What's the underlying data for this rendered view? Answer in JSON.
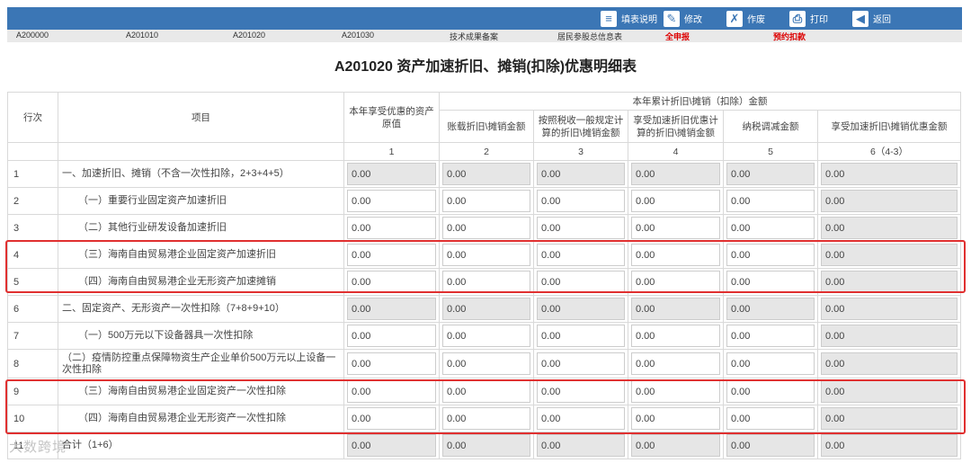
{
  "toolbar": {
    "buttons": [
      {
        "label": "填表说明",
        "icon": "document-icon"
      },
      {
        "label": "修改",
        "icon": "pencil-icon"
      },
      {
        "label": "作废",
        "icon": "void-document-icon"
      },
      {
        "label": "打印",
        "icon": "printer-icon"
      },
      {
        "label": "返回",
        "icon": "back-arrow-icon"
      }
    ]
  },
  "tabs": [
    "A200000",
    "A201010",
    "A201020",
    "A201030",
    "技术成果备案",
    "居民参股总信息表",
    "全申报",
    "预约扣款"
  ],
  "title": "A201020 资产加速折旧、摊销(扣除)优惠明细表",
  "header": {
    "row_no": "行次",
    "item": "项目",
    "col1": "本年享受优惠的资产原值",
    "group": "本年累计折旧\\摊销（扣除）金额",
    "col2": "账载折旧\\摊销金额",
    "col3": "按照税收一般规定计算的折旧\\摊销金额",
    "col4": "享受加速折旧优惠计算的折旧\\摊销金额",
    "col5": "纳税调减金额",
    "col6": "享受加速折旧\\摊销优惠金额",
    "nums": [
      "1",
      "2",
      "3",
      "4",
      "5",
      "6（4-3）"
    ]
  },
  "rows": [
    {
      "no": "1",
      "item": "一、加速折旧、摊销（不含一次性扣除，2+3+4+5）",
      "values": [
        "0.00",
        "0.00",
        "0.00",
        "0.00",
        "0.00",
        "0.00"
      ]
    },
    {
      "no": "2",
      "item": "（一）重要行业固定资产加速折旧",
      "values": [
        "0.00",
        "0.00",
        "0.00",
        "0.00",
        "0.00",
        "0.00"
      ]
    },
    {
      "no": "3",
      "item": "（二）其他行业研发设备加速折旧",
      "values": [
        "0.00",
        "0.00",
        "0.00",
        "0.00",
        "0.00",
        "0.00"
      ]
    },
    {
      "no": "4",
      "item": "（三）海南自由贸易港企业固定资产加速折旧",
      "values": [
        "0.00",
        "0.00",
        "0.00",
        "0.00",
        "0.00",
        "0.00"
      ]
    },
    {
      "no": "5",
      "item": "（四）海南自由贸易港企业无形资产加速摊销",
      "values": [
        "0.00",
        "0.00",
        "0.00",
        "0.00",
        "0.00",
        "0.00"
      ]
    },
    {
      "no": "6",
      "item": "二、固定资产、无形资产一次性扣除（7+8+9+10）",
      "values": [
        "0.00",
        "0.00",
        "0.00",
        "0.00",
        "0.00",
        "0.00"
      ]
    },
    {
      "no": "7",
      "item": "（一）500万元以下设备器具一次性扣除",
      "values": [
        "0.00",
        "0.00",
        "0.00",
        "0.00",
        "0.00",
        "0.00"
      ]
    },
    {
      "no": "8",
      "item": "（二）疫情防控重点保障物资生产企业单价500万元以上设备一次性扣除",
      "values": [
        "0.00",
        "0.00",
        "0.00",
        "0.00",
        "0.00",
        "0.00"
      ]
    },
    {
      "no": "9",
      "item": "（三）海南自由贸易港企业固定资产一次性扣除",
      "values": [
        "0.00",
        "0.00",
        "0.00",
        "0.00",
        "0.00",
        "0.00"
      ]
    },
    {
      "no": "10",
      "item": "（四）海南自由贸易港企业无形资产一次性扣除",
      "values": [
        "0.00",
        "0.00",
        "0.00",
        "0.00",
        "0.00",
        "0.00"
      ]
    },
    {
      "no": "11",
      "item": "合计（1+6）",
      "values": [
        "0.00",
        "0.00",
        "0.00",
        "0.00",
        "0.00",
        "0.00"
      ]
    }
  ],
  "watermark": "大数跨境"
}
